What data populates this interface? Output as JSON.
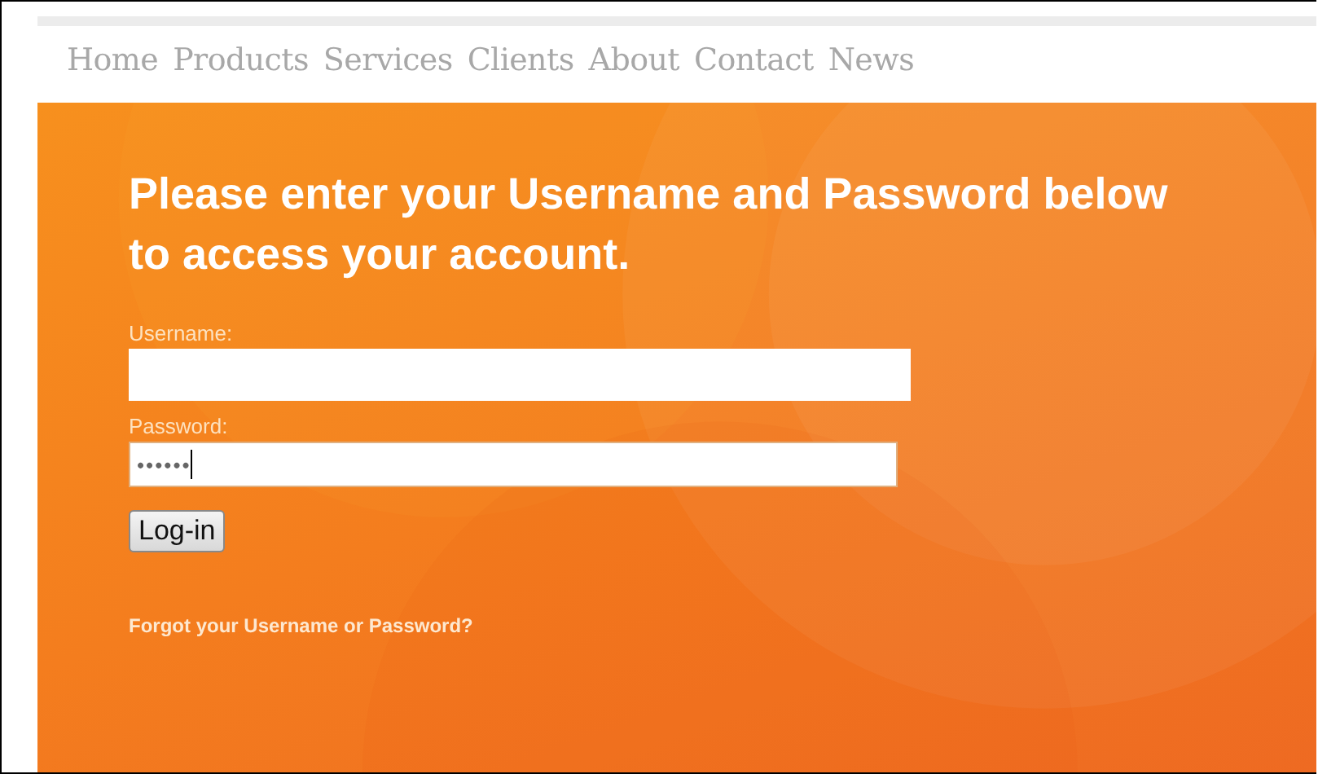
{
  "nav": [
    {
      "label": "Home"
    },
    {
      "label": "Products"
    },
    {
      "label": "Services"
    },
    {
      "label": "Clients"
    },
    {
      "label": "About"
    },
    {
      "label": "Contact"
    },
    {
      "label": "News"
    }
  ],
  "heading": "Please enter your Username and Password below to access your account.",
  "fields": [
    {
      "label": "Username:",
      "focused": false
    },
    {
      "label": "Password:",
      "value": "••••••",
      "focused": true
    }
  ],
  "button": "Log-in",
  "forgot_link": "Forgot your Username or Password?"
}
